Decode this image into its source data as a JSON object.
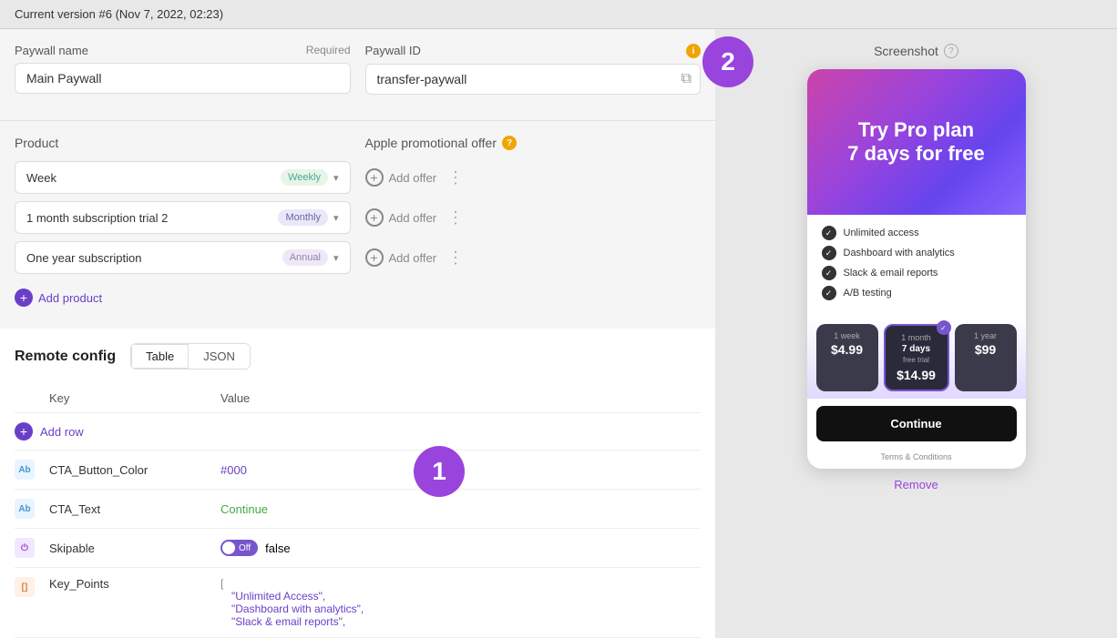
{
  "topbar": {
    "version_text": "Current version #6",
    "date_text": "(Nov 7, 2022, 02:23)"
  },
  "paywall_config": {
    "name_label": "Paywall name",
    "name_required": "Required",
    "name_value": "Main Paywall",
    "id_label": "Paywall ID",
    "id_value": "transfer-paywall"
  },
  "product_section": {
    "label": "Product",
    "apple_offer_label": "Apple promotional offer",
    "products": [
      {
        "name": "Week",
        "badge": "Weekly",
        "badge_class": "badge-weekly"
      },
      {
        "name": "1 month subscription trial 2",
        "badge": "Monthly",
        "badge_class": "badge-monthly"
      },
      {
        "name": "One year subscription",
        "badge": "Annual",
        "badge_class": "badge-annual"
      }
    ],
    "add_offer_label": "Add offer",
    "add_product_label": "Add product"
  },
  "remote_config": {
    "title": "Remote config",
    "tab_table": "Table",
    "tab_json": "JSON",
    "col_key": "Key",
    "col_value": "Value",
    "add_row_label": "Add row",
    "rows": [
      {
        "type": "Ab",
        "type_class": "type-ab",
        "key": "CTA_Button_Color",
        "value": "#000",
        "value_class": "value-purple"
      },
      {
        "type": "Ab",
        "type_class": "type-ab",
        "key": "CTA_Text",
        "value": "Continue",
        "value_class": "value-green"
      },
      {
        "type": "toggle",
        "type_class": "type-toggle",
        "key": "Skipable",
        "value": "false",
        "has_toggle": true
      },
      {
        "type": "[]",
        "type_class": "type-array",
        "key": "Key_Points",
        "value": "[",
        "is_array": true,
        "array_items": [
          "\"Unlimited Access\",",
          "\"Dashboard with analytics\",",
          "\"Slack & email reports\","
        ]
      }
    ]
  },
  "screenshot": {
    "label": "Screenshot",
    "title_line1": "Try Pro plan",
    "title_line2": "7 days for free",
    "features": [
      "Unlimited access",
      "Dashboard with analytics",
      "Slack & email reports",
      "A/B testing"
    ],
    "plans": [
      {
        "label": "1 week",
        "name": "",
        "sub": "",
        "price": "$4.99",
        "selected": false
      },
      {
        "label": "1 month",
        "name": "7 days",
        "sub": "free trial",
        "price": "$14.99",
        "selected": true
      },
      {
        "label": "1 year",
        "name": "",
        "sub": "",
        "price": "$99",
        "selected": false
      }
    ],
    "continue_btn": "Continue",
    "terms_text": "Terms & Conditions",
    "remove_btn": "Remove"
  },
  "badges": {
    "badge1_text": "1",
    "badge2_text": "2"
  }
}
